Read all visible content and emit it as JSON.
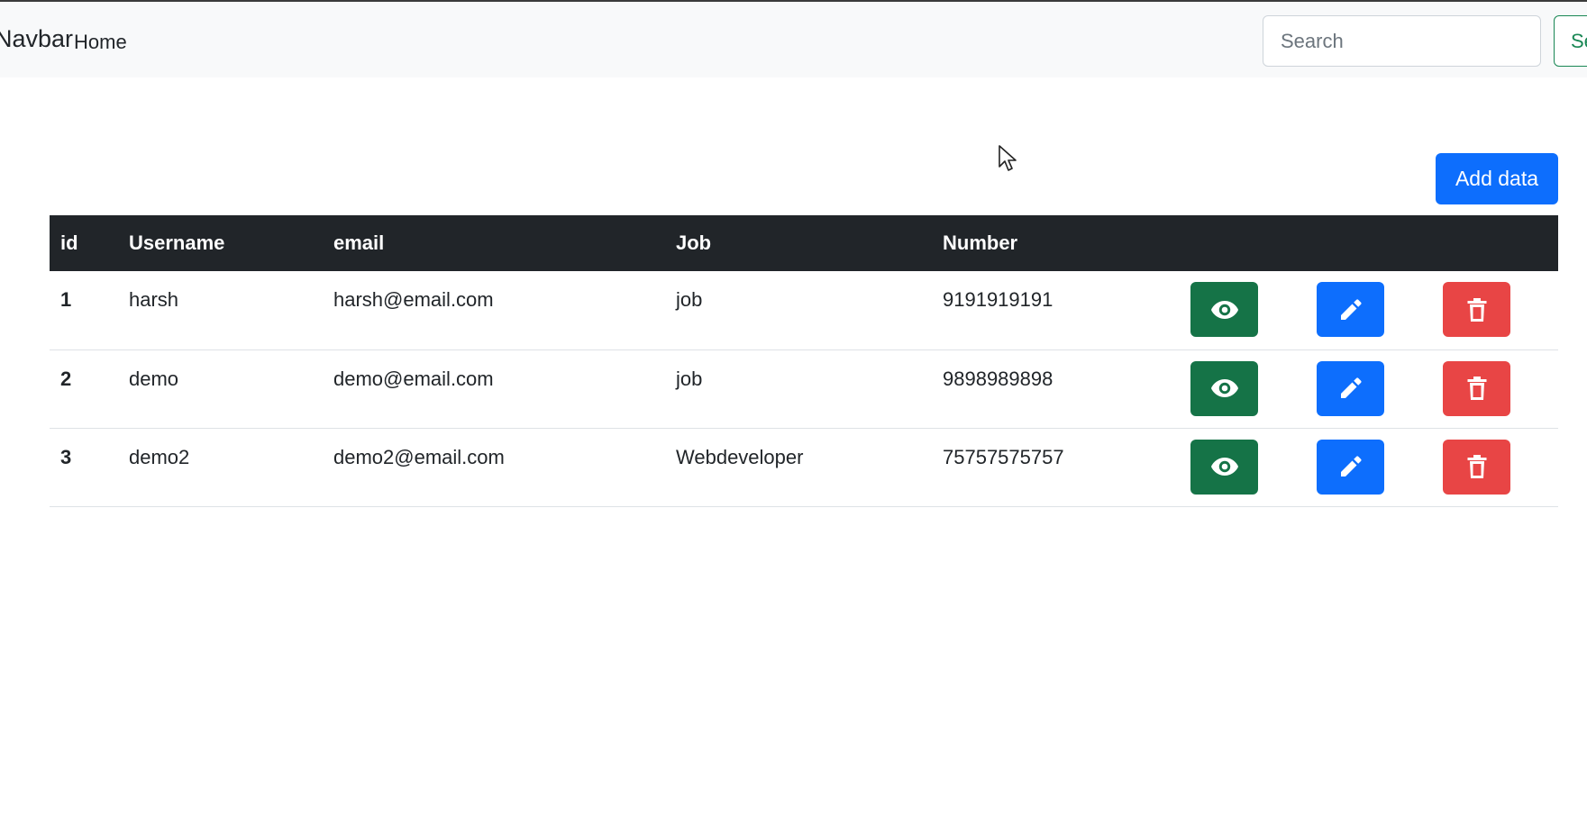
{
  "navbar": {
    "brand": "Navbar",
    "home_label": "Home",
    "search_placeholder": "Search",
    "search_button_label": "Search"
  },
  "actions": {
    "add_label": "Add data"
  },
  "table": {
    "headers": [
      "id",
      "Username",
      "email",
      "Job",
      "Number"
    ],
    "rows": [
      {
        "id": "1",
        "username": "harsh",
        "email": "harsh@email.com",
        "job": "job",
        "number": "9191919191"
      },
      {
        "id": "2",
        "username": "demo",
        "email": "demo@email.com",
        "job": "job",
        "number": "9898989898"
      },
      {
        "id": "3",
        "username": "demo2",
        "email": "demo2@email.com",
        "job": "Webdeveloper",
        "number": "75757575757"
      }
    ],
    "row_action_icons": [
      "eye-icon",
      "pencil-icon",
      "trash-icon"
    ]
  },
  "colors": {
    "navbar_bg": "#f8f9fa",
    "header_bg": "#212529",
    "primary": "#0d6efd",
    "success": "#157347",
    "danger": "#e84545"
  }
}
